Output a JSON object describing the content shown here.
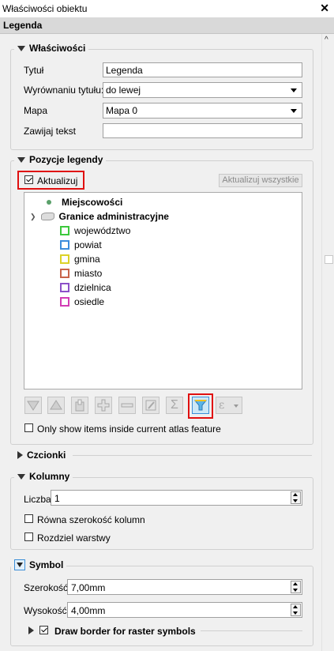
{
  "titlebar": {
    "title": "Właściwości obiektu",
    "close": "✕"
  },
  "section_header": "Legenda",
  "properties": {
    "group_title": "Właściwości",
    "title_label": "Tytuł",
    "title_value": "Legenda",
    "align_label": "Wyrównaniu tytułu:",
    "align_value": "do lewej",
    "map_label": "Mapa",
    "map_value": "Mapa 0",
    "wrap_label": "Zawijaj tekst",
    "wrap_value": ""
  },
  "legend_items": {
    "group_title": "Pozycje legendy",
    "auto_update_label": "Aktualizuj",
    "auto_update_checked": true,
    "update_all_label": "Aktualizuj wszystkie",
    "tree": [
      {
        "label": "Miejscowości",
        "bold": true,
        "icon": "point-symbol-icon",
        "level": 0
      },
      {
        "label": "Granice administracyjne",
        "bold": true,
        "icon": "polygon-layer-icon",
        "level": 0,
        "expanded": true
      }
    ],
    "classes": [
      {
        "label": "województwo",
        "color": "#3cc83c"
      },
      {
        "label": "powiat",
        "color": "#3c8cdc"
      },
      {
        "label": "gmina",
        "color": "#dcd228"
      },
      {
        "label": "miasto",
        "color": "#c8644a"
      },
      {
        "label": "dzielnica",
        "color": "#8c50c8"
      },
      {
        "label": "osiedle",
        "color": "#d23cb4"
      }
    ],
    "toolbar_icons": [
      "move-down-icon",
      "move-up-icon",
      "add-group-icon",
      "add-item-icon",
      "remove-item-icon",
      "edit-item-icon",
      "sum-icon",
      "filter-legend-icon",
      "expression-icon"
    ],
    "atlas_only_label": "Only show items inside current atlas feature",
    "atlas_only_checked": false
  },
  "fonts": {
    "group_title": "Czcionki"
  },
  "columns": {
    "group_title": "Kolumny",
    "count_label": "Liczba",
    "count_value": "1",
    "equal_width_label": "Równa szerokość kolumn",
    "equal_width_checked": false,
    "split_layers_label": "Rozdziel warstwy",
    "split_layers_checked": false
  },
  "symbol": {
    "group_title": "Symbol",
    "width_label": "Szerokość",
    "width_value": "7,00mm",
    "height_label": "Wysokość",
    "height_value": "4,00mm",
    "raster_border_label": "Draw border for raster symbols",
    "raster_border_checked": true
  },
  "colors": {
    "highlight": "#e01010"
  }
}
